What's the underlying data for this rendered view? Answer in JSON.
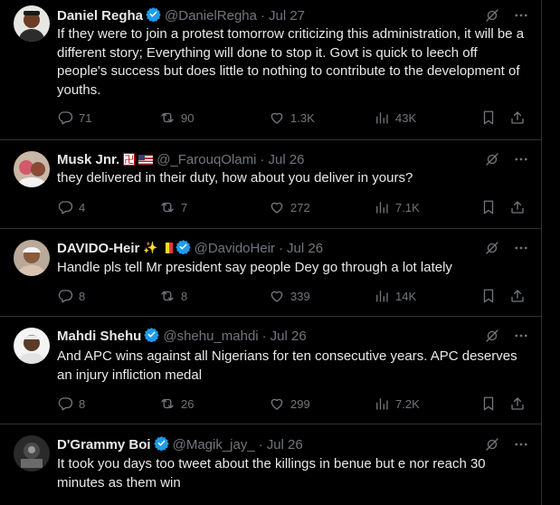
{
  "tweets": [
    {
      "name": "Daniel Regha",
      "handle": "@DanielRegha",
      "date": "Jul 27",
      "text": "If they were to join a protest tomorrow criticizing this administration, it will be a different story; Everything will done to stop it. Govt is quick to leech off people's success but does little to nothing to contribute to the development of youths.",
      "replies": "71",
      "reposts": "90",
      "likes": "1.3K",
      "views": "43K"
    },
    {
      "name": "Musk Jnr.",
      "handle": "@_FarouqOlami",
      "date": "Jul 26",
      "text": "they delivered in their duty, how about you deliver in yours?",
      "replies": "4",
      "reposts": "7",
      "likes": "272",
      "views": "7.1K"
    },
    {
      "name": "DAVIDO-Heir",
      "handle": "@DavidoHeir",
      "date": "Jul 26",
      "text": "Handle pls tell Mr president say people Dey go through a lot lately",
      "replies": "8",
      "reposts": "8",
      "likes": "339",
      "views": "14K"
    },
    {
      "name": "Mahdi Shehu",
      "handle": "@shehu_mahdi",
      "date": "Jul 26",
      "text": "And APC wins against all Nigerians for ten consecutive years. APC deserves an injury infliction  medal",
      "replies": "8",
      "reposts": "26",
      "likes": "299",
      "views": "7.2K"
    },
    {
      "name": "D'Grammy Boi",
      "handle": "@Magik_jay_",
      "date": "Jul 26",
      "text": "It took you days too tweet about the killings in benue but e nor reach 30 minutes as them win"
    }
  ],
  "colors": {
    "background": "#000000",
    "text": "#e7e9ea",
    "muted": "#71767b",
    "divider": "#2f3336",
    "verified": "#1d9bf0"
  }
}
